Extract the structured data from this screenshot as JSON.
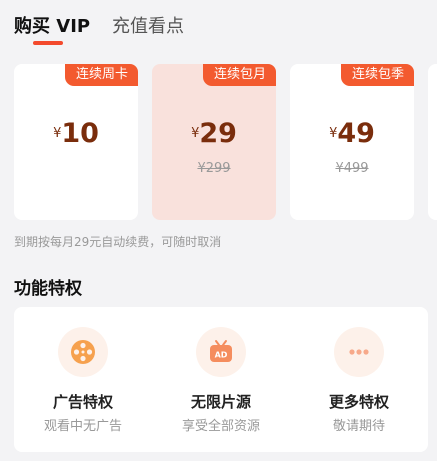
{
  "tabs": [
    {
      "label": "购买 VIP",
      "active": true
    },
    {
      "label": "充值看点",
      "active": false
    }
  ],
  "plans": [
    {
      "tag": "连续周卡",
      "currency": "¥",
      "price": "10",
      "original": "",
      "selected": false
    },
    {
      "tag": "连续包月",
      "currency": "¥",
      "price": "29",
      "original": "¥299",
      "selected": true
    },
    {
      "tag": "连续包季",
      "currency": "¥",
      "price": "49",
      "original": "¥499",
      "selected": false
    }
  ],
  "note": "到期按每月29元自动续费，可随时取消",
  "privileges_title": "功能特权",
  "privileges": [
    {
      "title": "广告特权",
      "subtitle": "观看中无广告",
      "icon": "film-reel-icon"
    },
    {
      "title": "无限片源",
      "subtitle": "享受全部资源",
      "icon": "tv-icon"
    },
    {
      "title": "更多特权",
      "subtitle": "敬请期待",
      "icon": "more-dots-icon"
    }
  ],
  "colors": {
    "accent": "#f35a2f",
    "price": "#7a2d0c",
    "selected_card": "#f9e1dc",
    "icon_bg": "#fdf1ea"
  }
}
